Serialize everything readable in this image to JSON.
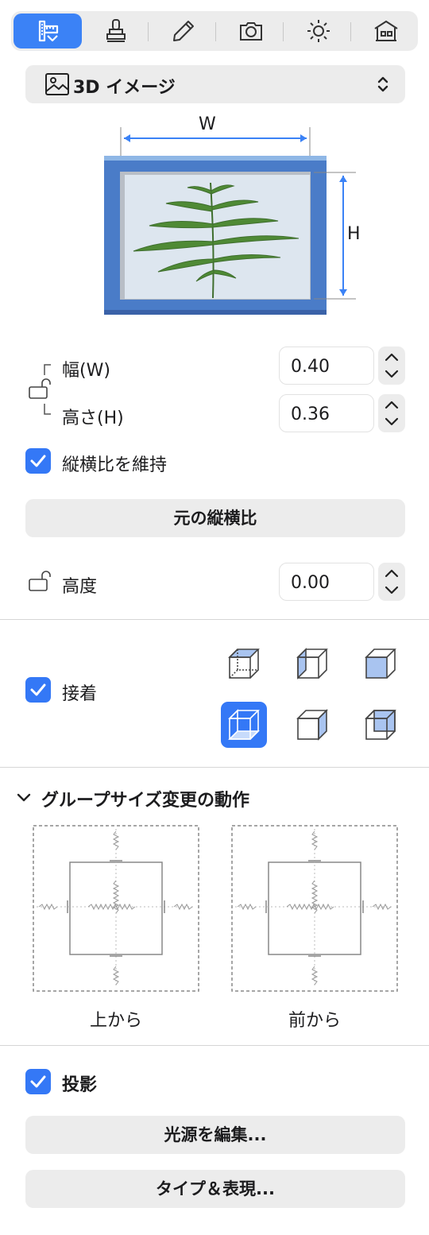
{
  "toolbar": {
    "tabs": [
      {
        "icon": "ruler-ruler-icon",
        "active": true
      },
      {
        "icon": "stamp-icon",
        "active": false
      },
      {
        "icon": "pencil-icon",
        "active": false
      },
      {
        "icon": "camera-icon",
        "active": false
      },
      {
        "icon": "sun-icon",
        "active": false
      },
      {
        "icon": "house-icon",
        "active": false
      }
    ]
  },
  "object_type": {
    "label": "3D イメージ",
    "icon": "image-icon"
  },
  "preview": {
    "w_label": "W",
    "h_label": "H"
  },
  "size": {
    "width_label": "幅(W)",
    "width_value": "0.40",
    "height_label": "高さ(H)",
    "height_value": "0.36",
    "keep_ratio_label": "縦横比を維持",
    "keep_ratio_checked": true,
    "original_ratio_button": "元の縦横比"
  },
  "elevation": {
    "label": "高度",
    "value": "0.00"
  },
  "attach": {
    "label": "接着",
    "checked": true
  },
  "group_resize": {
    "title": "グループサイズ変更の動作",
    "top_caption": "上から",
    "front_caption": "前から"
  },
  "shadow": {
    "label": "投影",
    "checked": true,
    "light_button": "光源を編集...",
    "type_button": "タイプ＆表現..."
  },
  "colors": {
    "accent": "#3478f6",
    "frame": "#4a7cc8"
  }
}
